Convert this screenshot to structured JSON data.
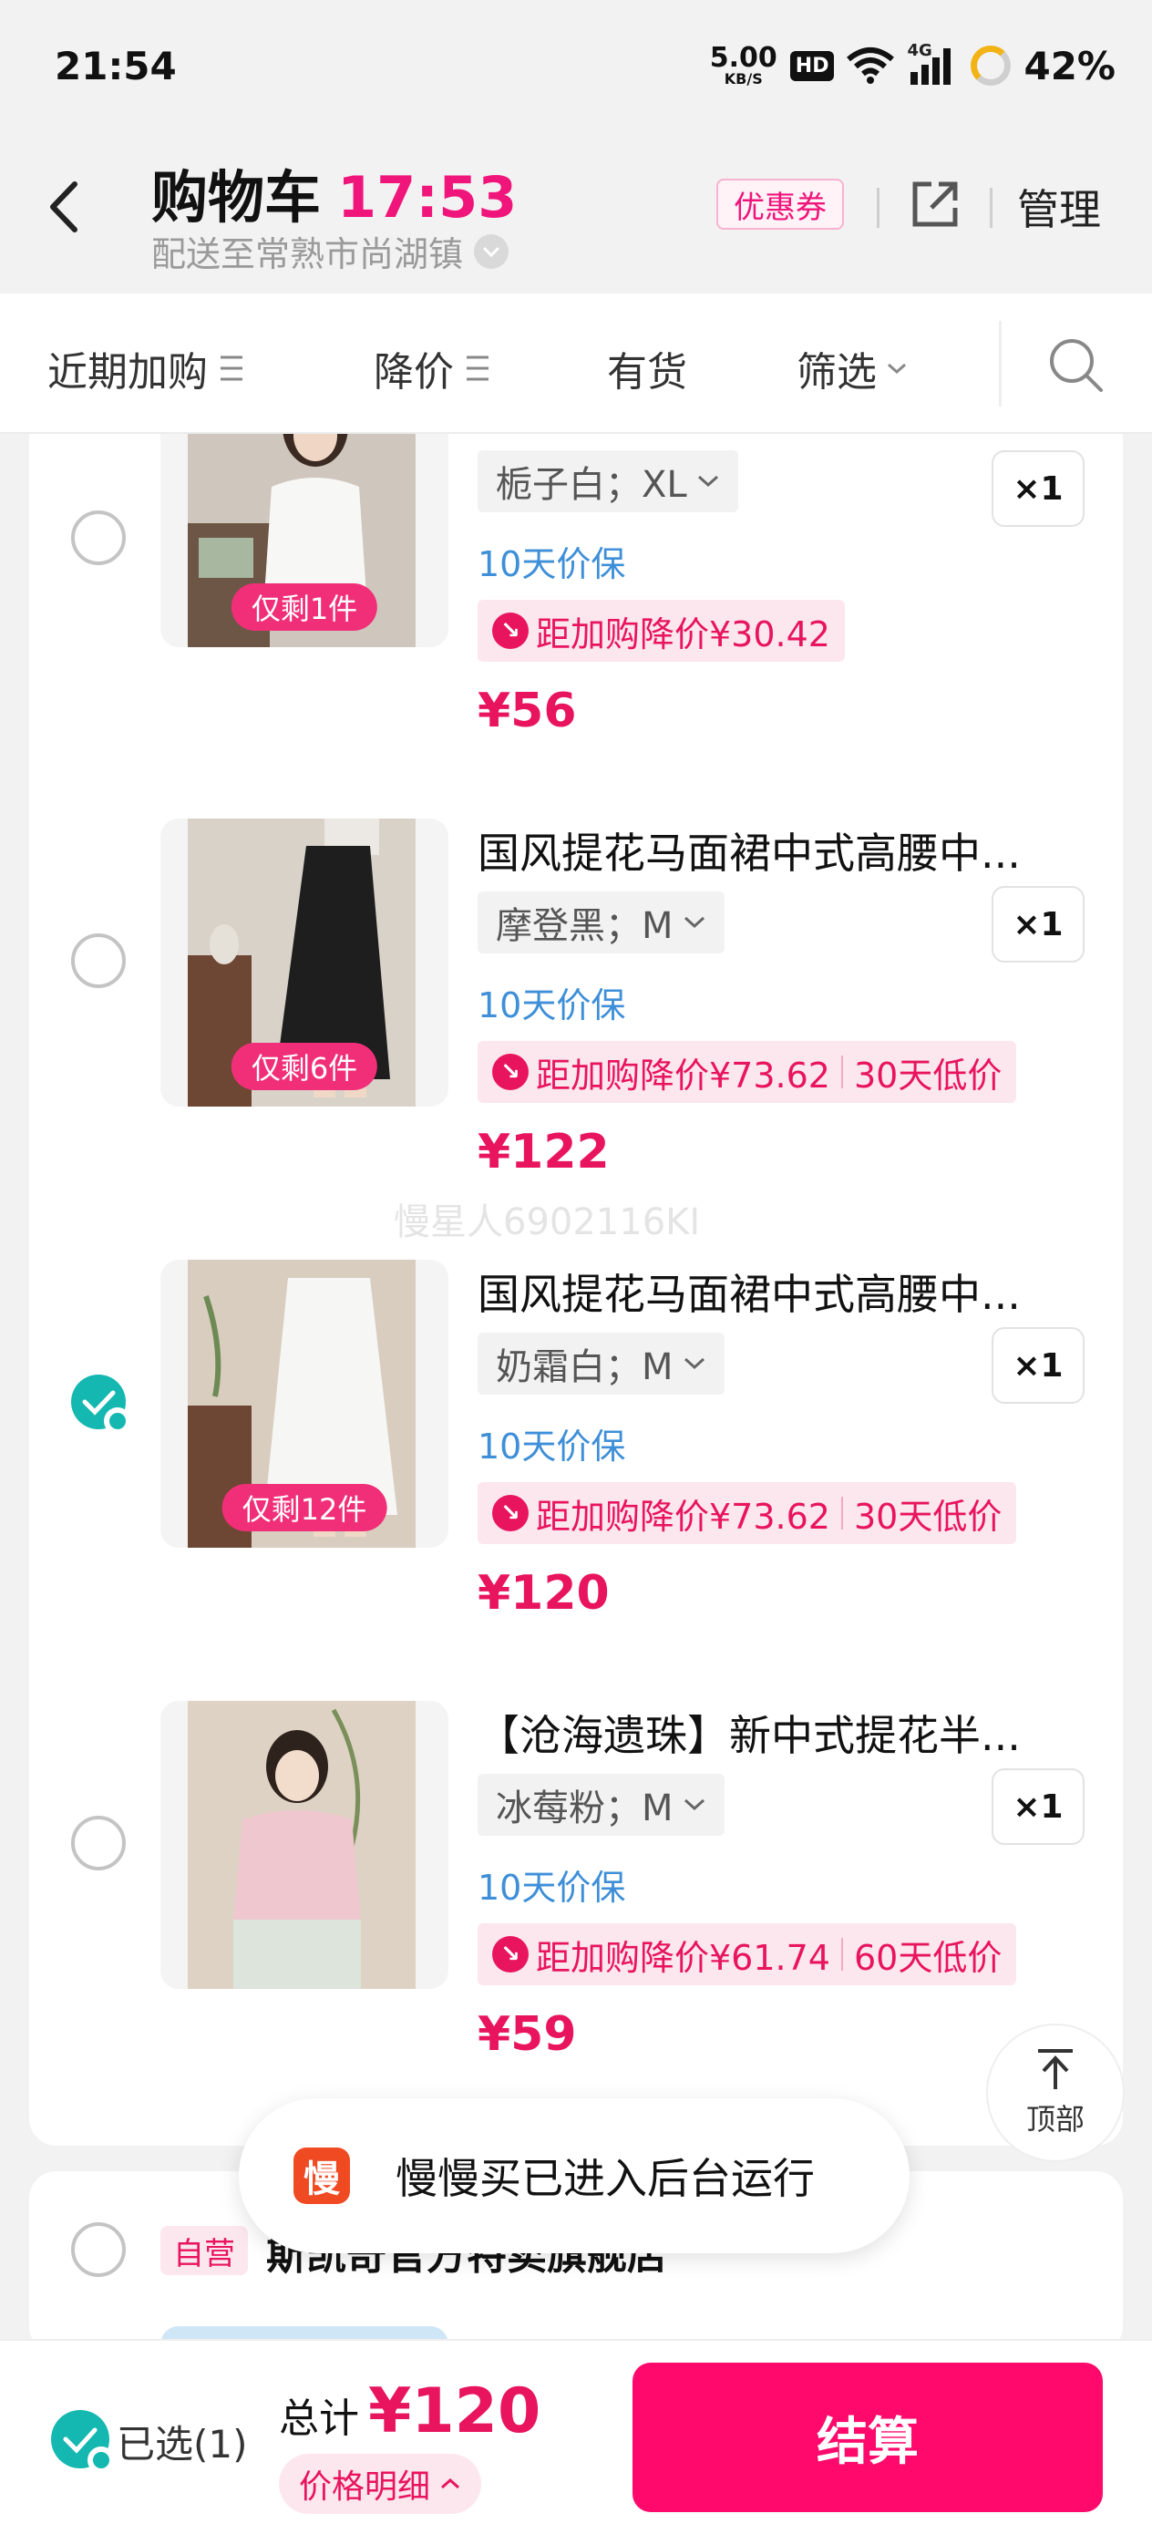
{
  "status_bar": {
    "time": "21:54",
    "net_speed": "5.00",
    "net_unit": "KB/S",
    "hd": "HD",
    "signal": "4G",
    "battery": "42%"
  },
  "header": {
    "title": "购物车",
    "timer": "17:53",
    "address": "配送至常熟市尚湖镇",
    "coupon": "优惠券",
    "manage": "管理"
  },
  "filters": [
    {
      "label": "近期加购"
    },
    {
      "label": "降价"
    },
    {
      "label": "有货"
    },
    {
      "label": "筛选"
    }
  ],
  "items": [
    {
      "name": "",
      "spec": "栀子白；XL",
      "qty": "×1",
      "guarantee": "10天价保",
      "drop": "距加购降价¥30.42",
      "low": "",
      "price": "¥56",
      "stock": "仅剩1件",
      "checked": false
    },
    {
      "name": "国风提花马面裙中式高腰中...",
      "spec": "摩登黑；M",
      "qty": "×1",
      "guarantee": "10天价保",
      "drop": "距加购降价¥73.62",
      "low": "30天低价",
      "price": "¥122",
      "stock": "仅剩6件",
      "checked": false
    },
    {
      "name": "国风提花马面裙中式高腰中...",
      "spec": "奶霜白；M",
      "qty": "×1",
      "guarantee": "10天价保",
      "drop": "距加购降价¥73.62",
      "low": "30天低价",
      "price": "¥120",
      "stock": "仅剩12件",
      "checked": true
    },
    {
      "name": "【沧海遗珠】新中式提花半...",
      "spec": "冰莓粉；M",
      "qty": "×1",
      "guarantee": "10天价保",
      "drop": "距加购降价¥61.74",
      "low": "60天低价",
      "price": "¥59",
      "stock": "",
      "checked": false
    }
  ],
  "watermark": "慢星人6902116KI",
  "back_to_top": "顶部",
  "store": {
    "tag": "自营",
    "name": "斯凯奇官方特卖旗舰店"
  },
  "toast": {
    "icon_char": "慢",
    "message": "慢慢买已进入后台运行"
  },
  "bottom": {
    "selected": "已选(1)",
    "total_label": "总计",
    "total": "¥120",
    "detail": "价格明细",
    "checkout": "结算"
  },
  "colors": {
    "accent": "#e8145e",
    "checkout": "#ff0a6c",
    "checked": "#14b8b0",
    "guarantee": "#3e8fd8"
  }
}
